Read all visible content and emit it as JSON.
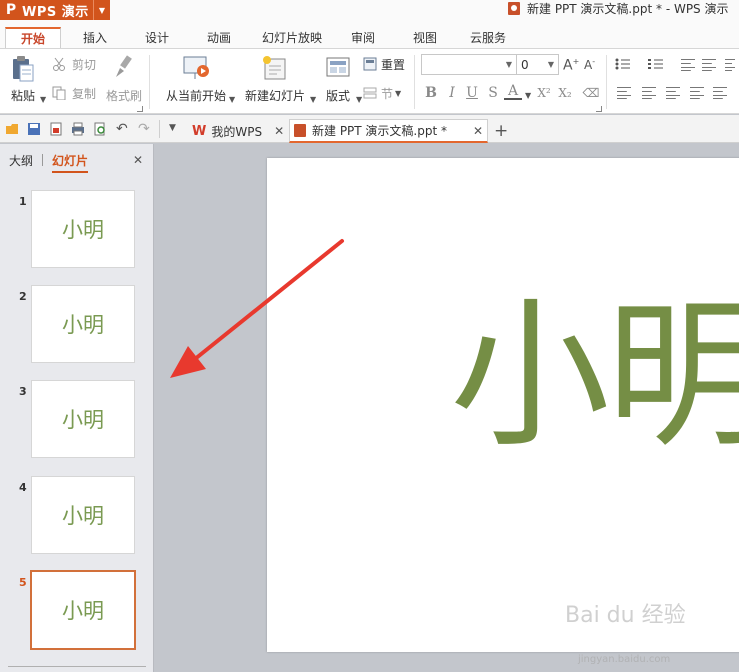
{
  "app": {
    "menu_label": "WPS 演示",
    "logo_glyph": "P",
    "brand_color": "#d2541c"
  },
  "window": {
    "title": "新建 PPT 演示文稿.ppt * - WPS 演示"
  },
  "tabs": [
    {
      "label": "开始",
      "active": true
    },
    {
      "label": "插入"
    },
    {
      "label": "设计"
    },
    {
      "label": "动画"
    },
    {
      "label": "幻灯片放映"
    },
    {
      "label": "审阅"
    },
    {
      "label": "视图"
    },
    {
      "label": "云服务"
    }
  ],
  "ribbon": {
    "paste": "粘贴",
    "cut": "剪切",
    "copy": "复制",
    "format_painter": "格式刷",
    "from_current": "从当前开始",
    "new_slide": "新建幻灯片",
    "layout": "版式",
    "reset": "重置",
    "section": "节",
    "font_name": "",
    "font_size": "0",
    "bold": "B",
    "italic": "I",
    "underline": "U",
    "strike": "S",
    "font_color": "A",
    "superscript": "X²",
    "subscript": "X₂"
  },
  "doc_tabs": [
    {
      "label": "我的WPS"
    },
    {
      "label": "新建 PPT 演示文稿.ppt *",
      "active": true
    }
  ],
  "panel": {
    "tabs": [
      {
        "label": "大纲"
      },
      {
        "label": "幻灯片",
        "active": true
      }
    ],
    "close": "✕",
    "slides": [
      {
        "number": "1",
        "text": "小明"
      },
      {
        "number": "2",
        "text": "小明"
      },
      {
        "number": "3",
        "text": "小明"
      },
      {
        "number": "4",
        "text": "小明"
      },
      {
        "number": "5",
        "text": "小明",
        "active": true
      }
    ]
  },
  "slide": {
    "text": "小明",
    "text_color": "#758e45"
  },
  "watermark": {
    "text": "Bai du 经验",
    "url": "jingyan.baidu.com"
  }
}
